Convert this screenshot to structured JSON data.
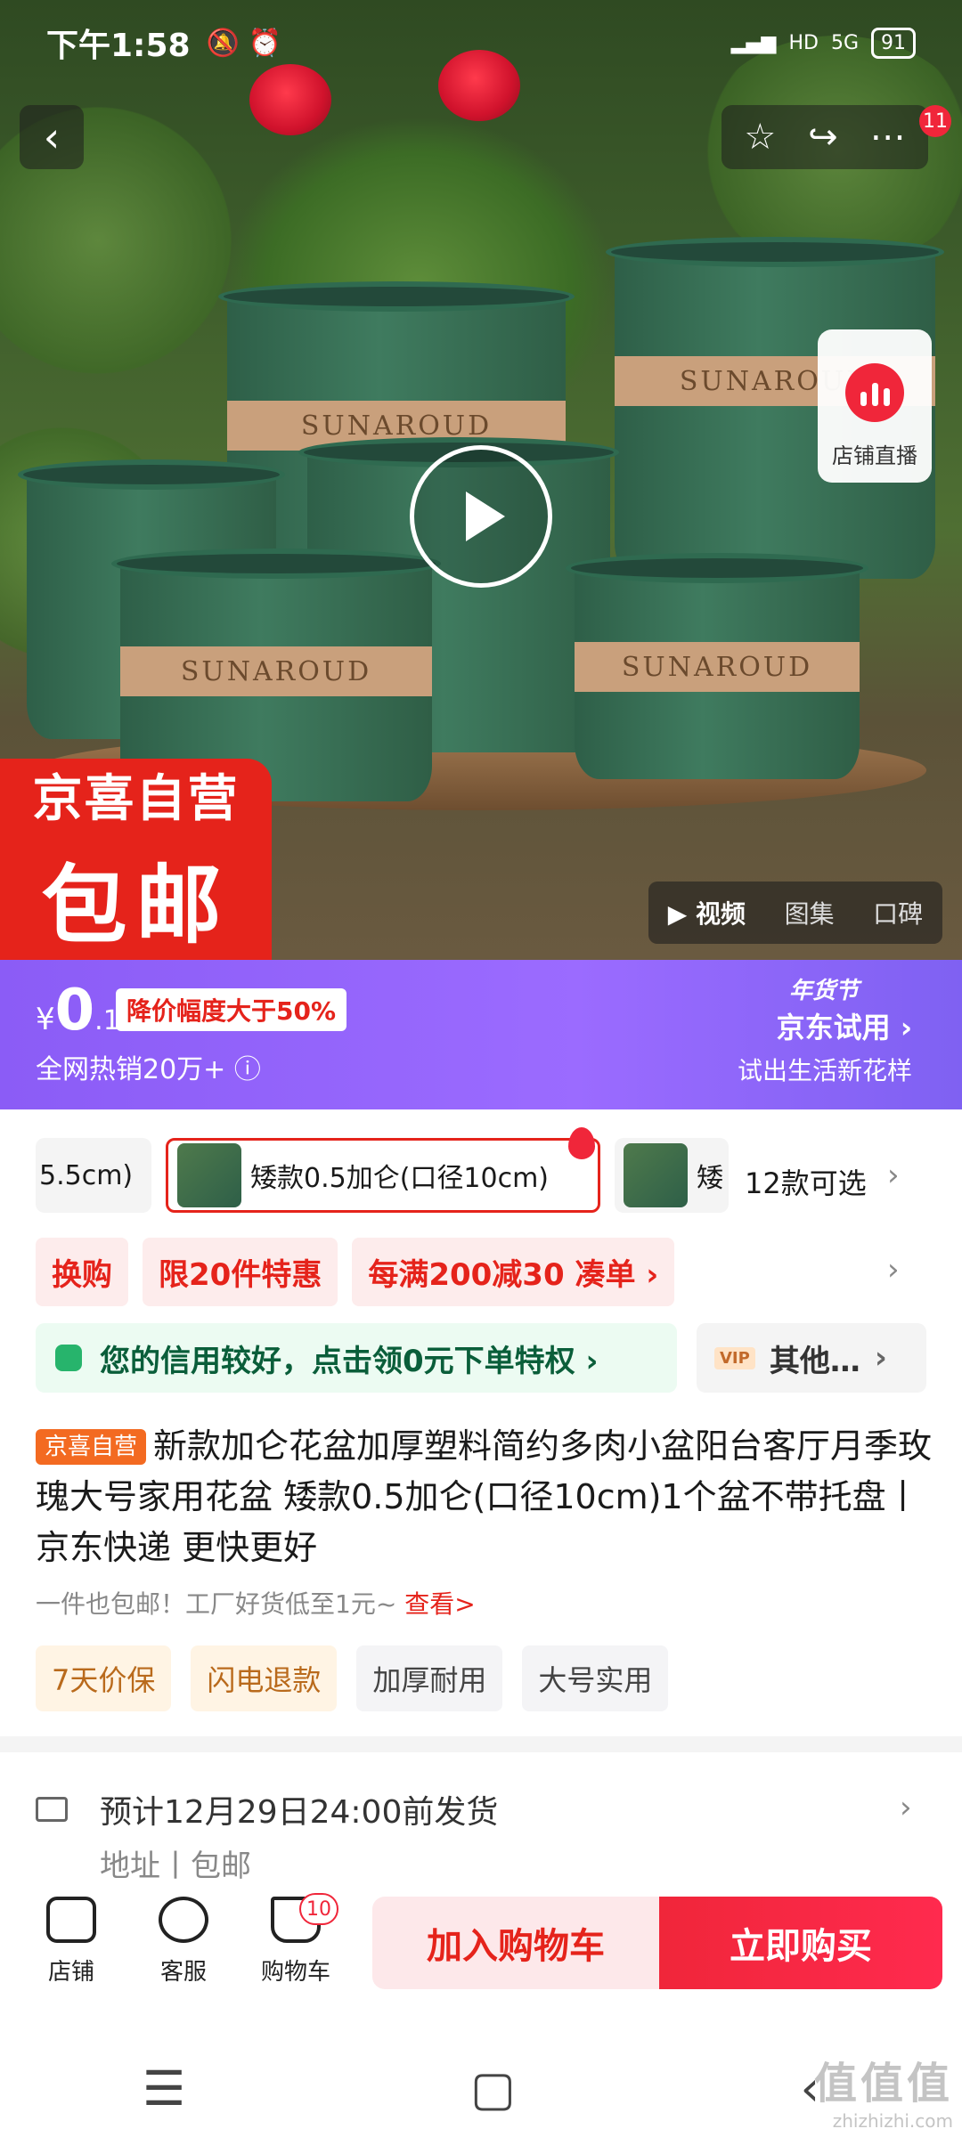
{
  "status_bar": {
    "time": "下午1:58",
    "network": "5G",
    "battery": "91",
    "hd": "HD"
  },
  "top": {
    "back_icon": "chevron-left-icon",
    "actions": [
      "star-icon",
      "share-icon",
      "more-icon"
    ],
    "notif_count": "11"
  },
  "gallery": {
    "live_label": "店铺直播",
    "promo_line1": "京喜自营",
    "promo_line2": "包邮",
    "tabs": [
      "▶ 视频",
      "图集",
      "口碑"
    ],
    "pot_text": [
      "SUNAROUD",
      "SUNAROUD",
      "SUNAROUD",
      "SUNAROUD"
    ]
  },
  "price": {
    "currency": "¥",
    "int": "0",
    "dec": ".1",
    "drop_tag": "降价幅度大于50%",
    "sold": "全网热销20万+",
    "trial_top": "年货节",
    "trial_title": "京东试用",
    "trial_sub": "试出生活新花样"
  },
  "variants": {
    "items": [
      "5.5cm)",
      "矮款0.5加仑(口径10cm)",
      "矮"
    ],
    "count_label": "12款可选"
  },
  "promos": [
    "换购",
    "限20件特惠",
    "每满200减30  凑单 ›"
  ],
  "credit": {
    "text": "您的信用较好，点击领0元下单特权 ›",
    "other": "其他…",
    "vip": "VIP"
  },
  "product": {
    "badge": "京喜自营",
    "title": "新款加仑花盆加厚塑料简约多肉小盆阳台客厅月季玫瑰大号家用花盆 矮款0.5加仑(口径10cm)1个盆不带托盘丨京东快递 更快更好",
    "subtitle": "一件也包邮！工厂好货低至1元~",
    "subtitle_link": "查看>",
    "badges": [
      "7天价保",
      "闪电退款",
      "加厚耐用",
      "大号实用"
    ]
  },
  "shipping": {
    "text": "预计12月29日24:00前发货",
    "addr": "地址",
    "free": "包邮"
  },
  "bottom": {
    "store": "店铺",
    "service": "客服",
    "cart": "购物车",
    "cart_count": "10",
    "add_cart": "加入购物车",
    "buy_now": "立即购买"
  },
  "sysnav": [
    "☰",
    "▢",
    "‹"
  ],
  "watermark": {
    "line1": "值值值",
    "line2": "zhizhizhi.com"
  }
}
